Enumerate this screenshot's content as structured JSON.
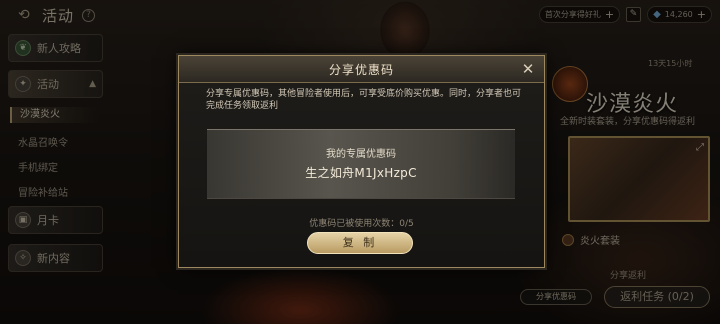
{
  "topbar": {
    "title": "活动",
    "help_symbol": "?",
    "pill_label": "首次分享得好礼",
    "currency_value": "14,260",
    "plus": "+"
  },
  "sidebar": {
    "items": [
      {
        "label": "新人攻略",
        "icon": "leaf-icon"
      },
      {
        "label": "活动",
        "icon": "activity-icon"
      },
      {
        "label": "月卡",
        "icon": "card-icon"
      },
      {
        "label": "新内容",
        "icon": "new-content-icon"
      }
    ],
    "sub_items": [
      "沙漠炎火",
      "水晶召唤令",
      "手机绑定",
      "冒险补给站"
    ]
  },
  "event": {
    "title": "沙漠炎火",
    "subtitle": "全新时装套装，分享优惠码得返利",
    "timer": "13天15小时",
    "item_label": "炎火套装",
    "share_reward_label": "分享返利",
    "share_button": "分享优惠码",
    "reward_task_button": "返利任务 (0/2)"
  },
  "dialog": {
    "title": "分享优惠码",
    "description": "分享专属优惠码，其他冒险者使用后，可享受底价购买优惠。同时，分享者也可完成任务领取返利",
    "code_label": "我的专属优惠码",
    "code_value": "生之如舟M1JxHzpC",
    "usage": "优惠码已被使用次数：0/5",
    "copy_button": "复 制"
  }
}
